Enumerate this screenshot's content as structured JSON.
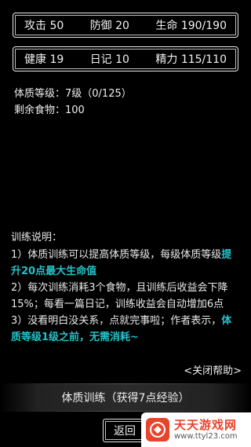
{
  "stats_row1": {
    "attack": "攻击 50",
    "defense": "防御 20",
    "life": "生命 190/190"
  },
  "stats_row2": {
    "health": "健康 19",
    "diary": "日记 10",
    "energy": "精力 115/110"
  },
  "physique_level": "体质等级：7级（0/125）",
  "remaining_food": "剩余食物：100",
  "help": {
    "title": "训练说明：",
    "l1_a": "1）体质训练可以提高体质等级，每级体质等级",
    "l1_hl": "提升20点最大生命值",
    "l2": "2）每次训练消耗3个食物，且训练后收益会下降15%；每看一篇日记，训练收益会自动增加6点",
    "l3_a": "3）没看明白没关系，点就完事啦；作者表示，",
    "l3_hl": "体质等级1级之前，无需消耗~",
    "close": "<关闭帮助>"
  },
  "train_button": "体质训练（获得7点经验）",
  "back_button": "返回",
  "watermark": {
    "title": "天天游戏网",
    "url": "www.ttyl23.com"
  },
  "colors": {
    "background": "#000000",
    "highlight": "#22c3c9",
    "watermark_brand": "#e8442c"
  }
}
